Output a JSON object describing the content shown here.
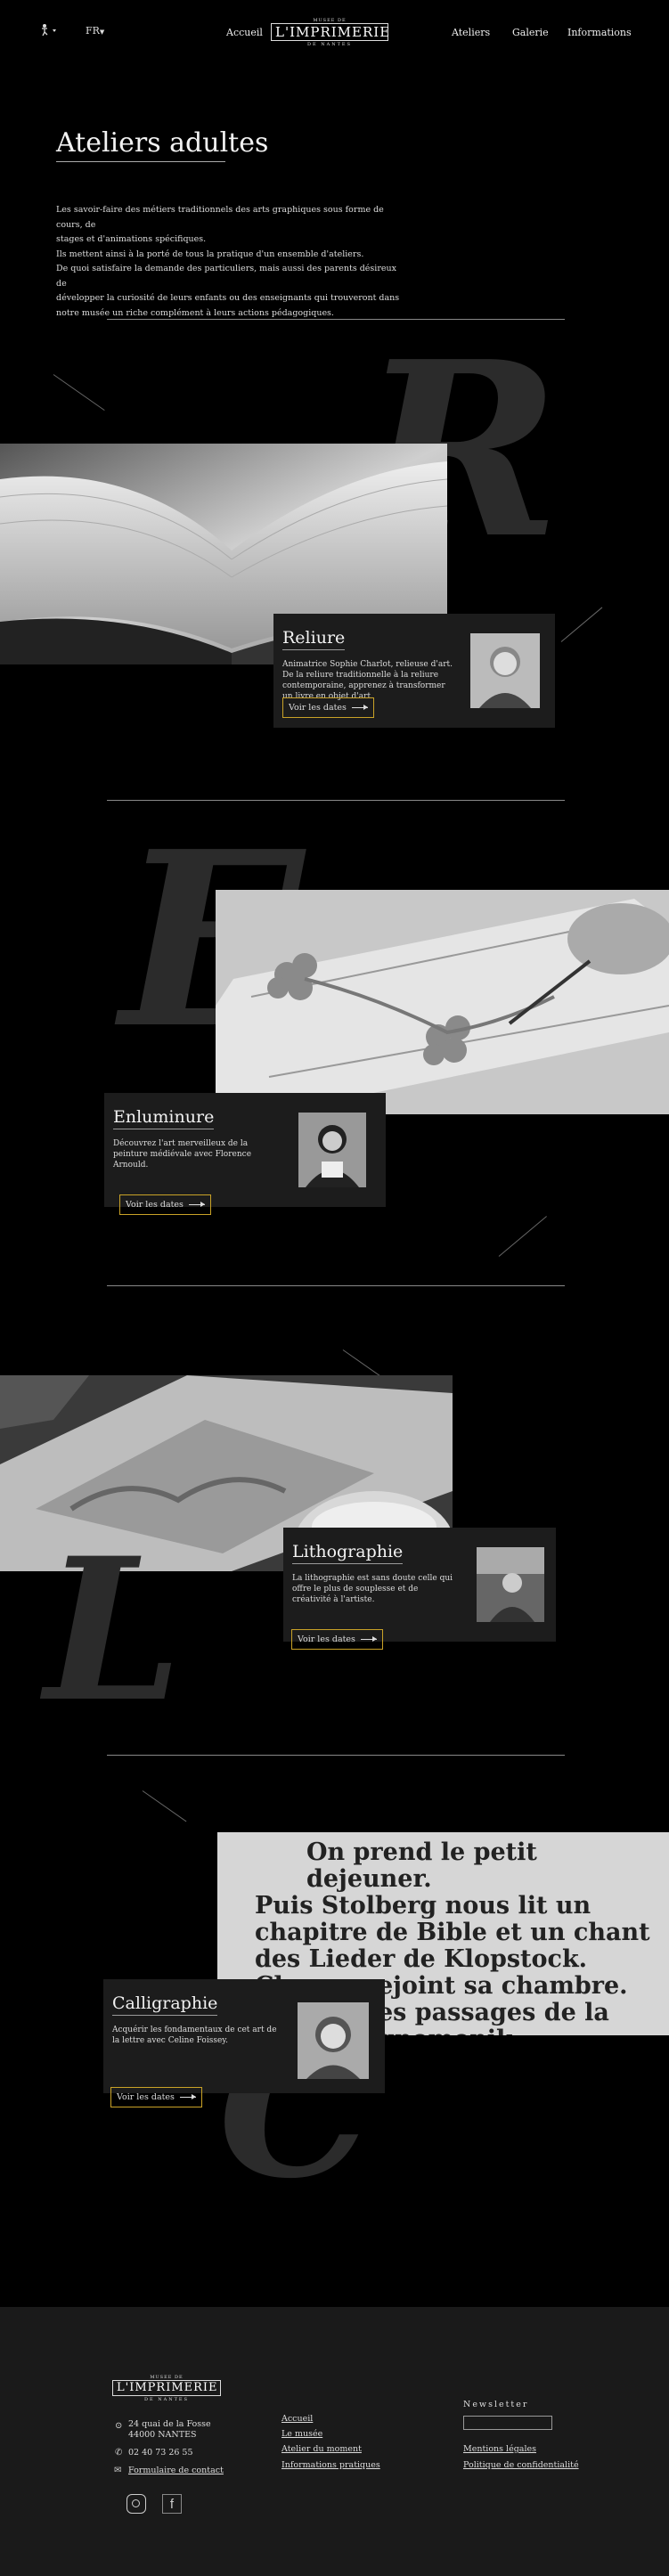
{
  "header": {
    "accessibility_icon": "accessibility-icon",
    "language": "FR",
    "nav": [
      "Accueil",
      "Ateliers",
      "Galerie",
      "Informations"
    ],
    "logo": {
      "top": "MUSEE DE",
      "main": "L'IMPRIMERIE",
      "bottom": "DE NANTES"
    }
  },
  "page": {
    "title": "Ateliers adultes",
    "intro": [
      "Les savoir-faire des métiers traditionnels des arts graphiques sous forme de cours, de",
      "stages  et d'animations spécifiques.",
      "Ils mettent ainsi à la porté de tous la pratique d'un ensemble d'ateliers.",
      "De quoi satisfaire la demande des particuliers, mais aussi des parents désireux de",
      "développer la curiosité de leurs enfants ou des enseignants qui trouveront dans",
      "notre musée un riche complément à leurs actions pédagogiques."
    ]
  },
  "ateliers": [
    {
      "title": "Reliure",
      "letter": "R",
      "desc": "Animatrice Sophie Charlot, relieuse d'art. De la reliure traditionnelle à la reliure contemporaine, apprenez à transformer un livre en objet d'art.",
      "button": "Voir les dates"
    },
    {
      "title": "Enluminure",
      "letter": "E",
      "desc": "Découvrez l'art merveilleux de la peinture médiévale avec Florence Arnould.",
      "button": "Voir les dates"
    },
    {
      "title": "Lithographie",
      "letter": "L",
      "desc": "La lithographie est sans doute celle qui offre le plus de souplesse et de créativité à l'artiste.",
      "button": "Voir les dates"
    },
    {
      "title": "Calligraphie",
      "letter": "C",
      "desc": "Acquérir les fondamentaux de cet art de la lettre avec Celine Foissey.",
      "button": "Voir les dates"
    }
  ],
  "calligraphy_text": [
    "On prend le petit dejeuner.",
    "Puis Stolberg nous lit un",
    "chapitre de Bible et un chant",
    "des Lieder de Klopstock.",
    "Chacun rejoint sa chambre.",
    "es passages de la",
    "gnomonik."
  ],
  "footer": {
    "logo": {
      "top": "MUSEE DE",
      "main": "L'IMPRIMERIE",
      "bottom": "DE NANTES"
    },
    "address_line1": "24 quai de la Fosse",
    "address_line2": "44000 NANTES",
    "phone": "02 40 73 26 55",
    "contact": "Formulaire de contact",
    "links": [
      "Accueil",
      "Le musée",
      "Atelier du moment",
      "Informations pratiques"
    ],
    "newsletter": "Newsletter",
    "legal": [
      "Mentions légales",
      "Politique de confidentialité"
    ]
  },
  "colors": {
    "accent": "#c9a227",
    "card": "#1c1c1c",
    "footer": "#1a1a1a"
  }
}
